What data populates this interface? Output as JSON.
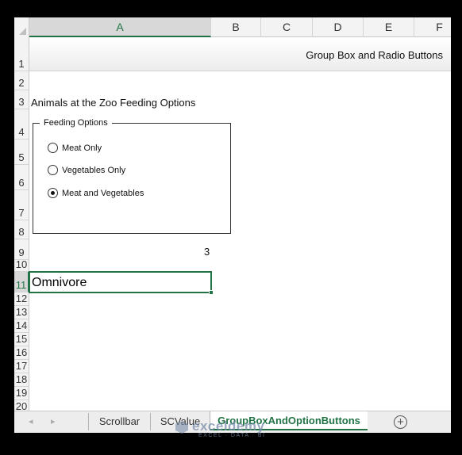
{
  "columns": [
    "A",
    "B",
    "C",
    "D",
    "E",
    "F"
  ],
  "rows": [
    "1",
    "2",
    "3",
    "4",
    "5",
    "6",
    "7",
    "8",
    "9",
    "10",
    "11",
    "12",
    "13",
    "14",
    "15",
    "16",
    "17",
    "18",
    "19",
    "20"
  ],
  "banner": {
    "title": "Group Box and Radio Buttons"
  },
  "cells": {
    "a3": "Animals at the Zoo Feeding Options",
    "b9": "3",
    "a11": "Omnivore"
  },
  "group_box": {
    "title": "Feeding Options",
    "options": [
      {
        "label": "Meat Only",
        "checked": false
      },
      {
        "label": "Vegetables Only",
        "checked": false
      },
      {
        "label": "Meat and Vegetables",
        "checked": true
      }
    ]
  },
  "tabs": [
    {
      "label": "Scrollbar",
      "active": false
    },
    {
      "label": "SCValue",
      "active": false
    },
    {
      "label": "GroupBoxAndOptionButtons",
      "active": true
    }
  ],
  "nav": {
    "prev": "◂",
    "next": "▸",
    "add": "+"
  },
  "watermark": {
    "name": "exceldemy",
    "sub": "EXCEL · DATA · BI"
  },
  "colors": {
    "accent": "#217346"
  }
}
